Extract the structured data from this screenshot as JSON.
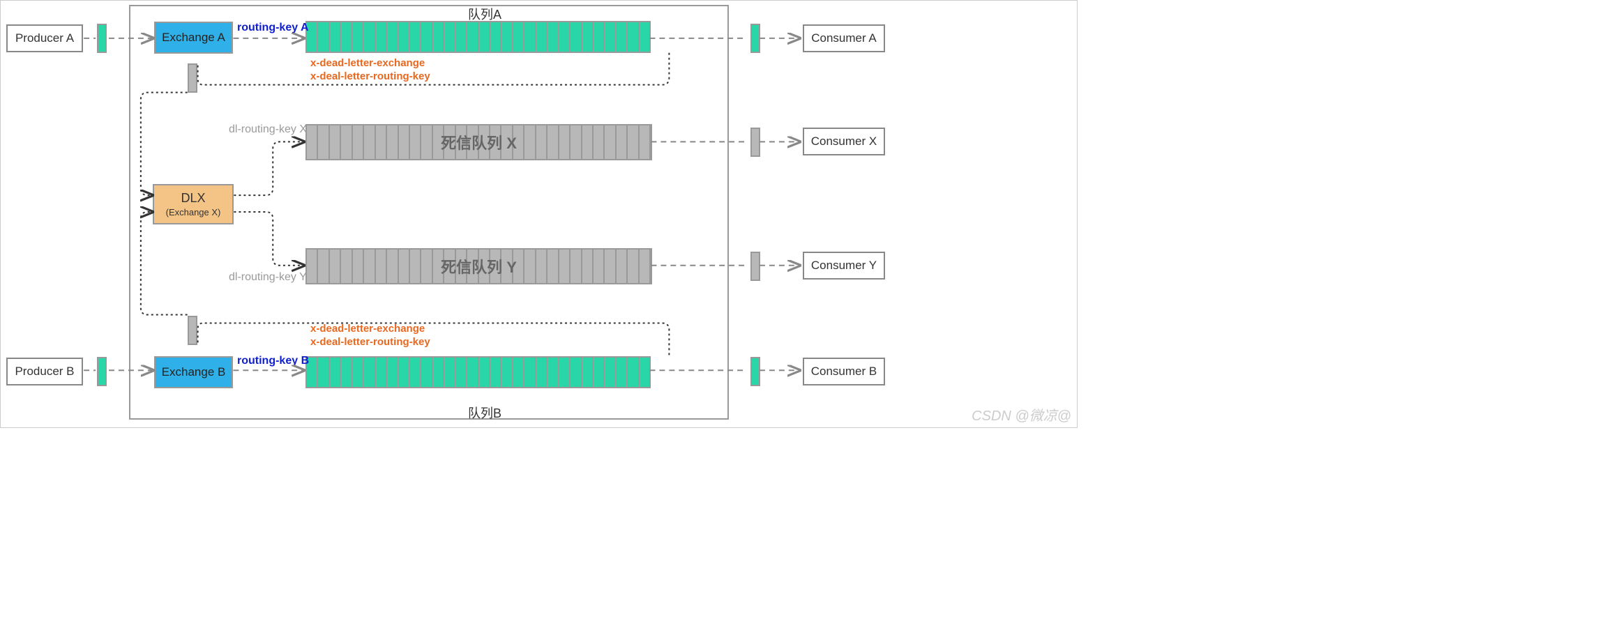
{
  "producers": {
    "a": "Producer A",
    "b": "Producer B"
  },
  "consumers": {
    "a": "Consumer A",
    "x": "Consumer X",
    "y": "Consumer Y",
    "b": "Consumer B"
  },
  "exchanges": {
    "a": "Exchange A",
    "b": "Exchange B"
  },
  "dlx": {
    "title": "DLX",
    "sub": "(Exchange X)"
  },
  "queues": {
    "a_label": "队列A",
    "b_label": "队列B",
    "x_label": "死信队列 X",
    "y_label": "死信队列 Y"
  },
  "routing": {
    "a": "routing-key A",
    "b": "routing-key B",
    "dl_x": "dl-routing-key X",
    "dl_y": "dl-routing-key Y"
  },
  "dead_letter_args": {
    "line1": "x-dead-letter-exchange",
    "line2": "x-deal-letter-routing-key"
  },
  "watermark": "CSDN @微凉@",
  "colors": {
    "exchange_bg": "#30B0E8",
    "dlx_bg": "#F4C486",
    "queue_green": "#28D6A8",
    "queue_grey": "#B8B8B8",
    "routing_key": "#1020D0",
    "dead_letter_text": "#E86820",
    "dashed_line": "#888888",
    "dotted_line": "#333333"
  }
}
